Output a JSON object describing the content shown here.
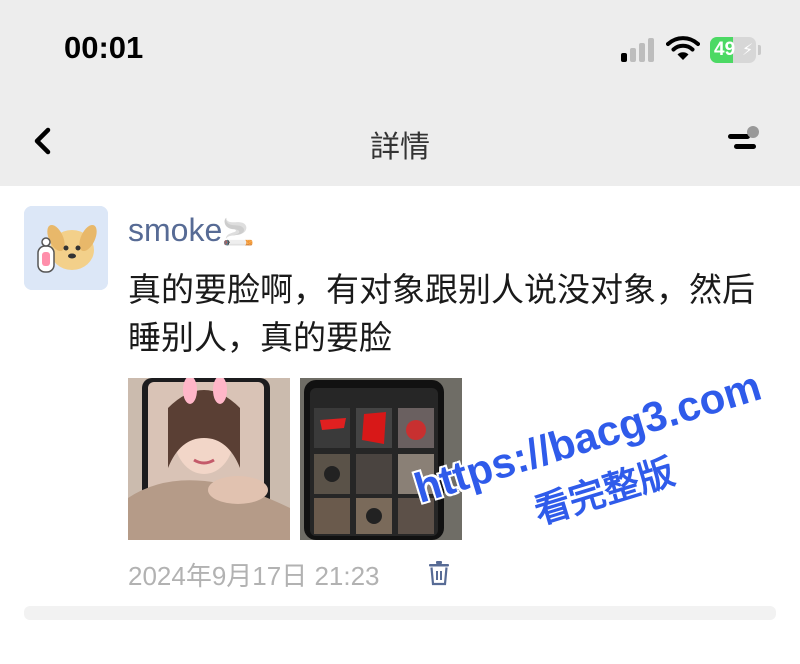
{
  "status_bar": {
    "time": "00:01",
    "battery_level": "49",
    "battery_fraction": 0.49,
    "icons": [
      "signal-icon",
      "wifi-icon",
      "battery-icon",
      "charging-bolt-icon"
    ]
  },
  "nav": {
    "title": "詳情",
    "back_icon": "chevron-left-icon",
    "more_icon": "more-options-icon"
  },
  "post": {
    "username": "smoke",
    "username_emoji": "🚬",
    "text": "真的要脸啊，有对象跟别人说没对象，然后睡别人，真的要脸",
    "images": [
      "photo-1",
      "photo-2"
    ],
    "timestamp": "2024年9月17日  21:23",
    "delete_icon": "trash-icon"
  },
  "watermark": {
    "url": "https://bacg3.com",
    "caption": "看完整版"
  },
  "colors": {
    "header_bg": "#ededed",
    "username": "#576b95",
    "timestamp": "#b2b2b2",
    "watermark": "#2f5bea",
    "battery": "#4cd964"
  }
}
